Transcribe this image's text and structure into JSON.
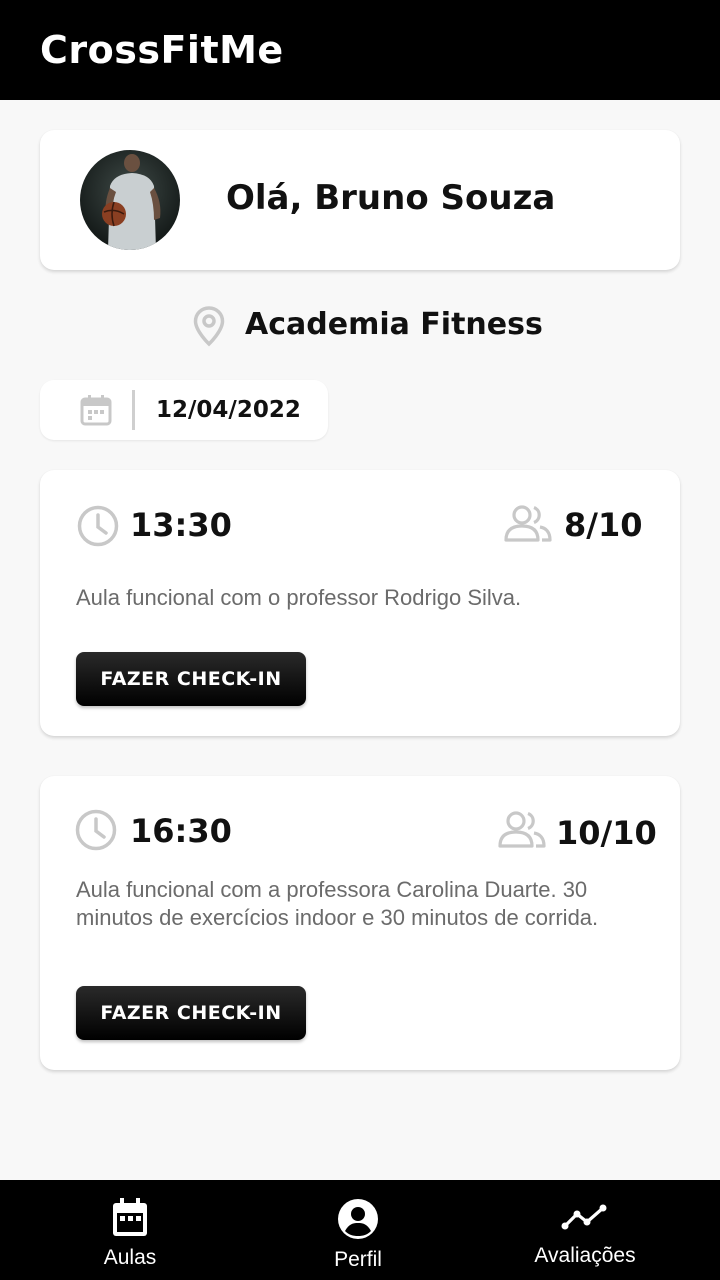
{
  "app": {
    "title": "CrossFitMe"
  },
  "profile": {
    "greeting": "Olá, Bruno Souza"
  },
  "location": {
    "name": "Academia Fitness",
    "icon": "map-pin-icon"
  },
  "date": {
    "value": "12/04/2022",
    "icon": "calendar-icon"
  },
  "classes": [
    {
      "time": "13:30",
      "capacity": "8/10",
      "description": "Aula funcional com o professor Rodrigo Silva.",
      "button_label": "FAZER CHECK-IN"
    },
    {
      "time": "16:30",
      "capacity": "10/10",
      "description": "Aula funcional com a professora Carolina Duarte. 30 minutos de exercícios indoor e 30 minutos de corrida.",
      "button_label": "FAZER CHECK-IN"
    }
  ],
  "bottom_nav": {
    "items": [
      {
        "label": "Aulas",
        "icon": "calendar-icon"
      },
      {
        "label": "Perfil",
        "icon": "account-circle-icon"
      },
      {
        "label": "Avaliações",
        "icon": "trending-line-icon"
      }
    ]
  },
  "colors": {
    "appbar": "#000000",
    "background": "#f8f8f8",
    "card": "#ffffff",
    "muted_icon": "#c8c8c8",
    "description_text": "#6b6b6b"
  }
}
